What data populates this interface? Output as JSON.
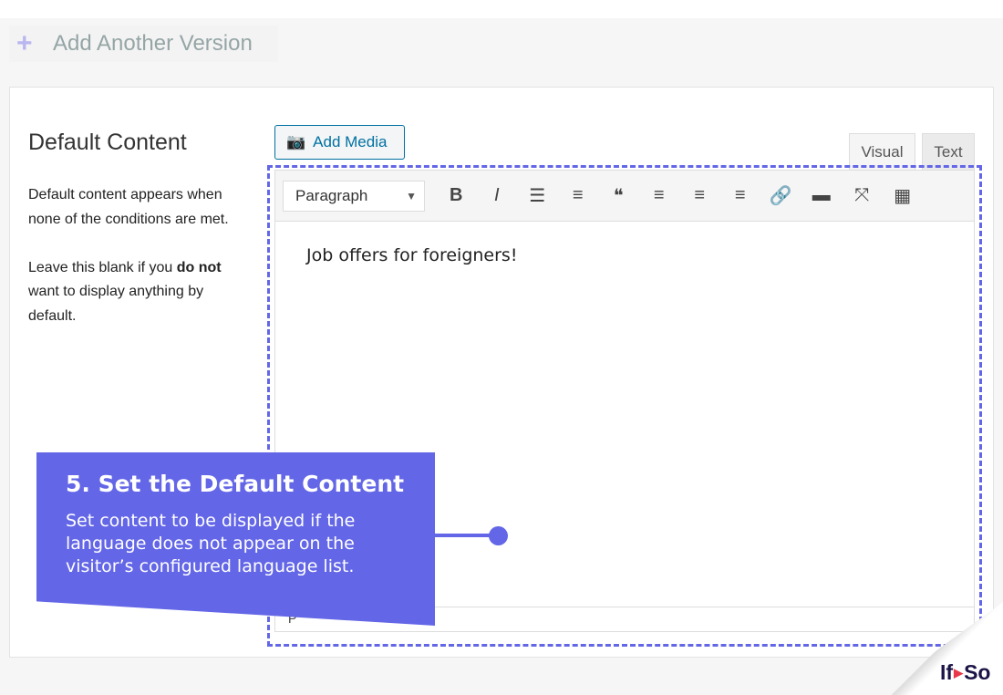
{
  "add_version": {
    "icon": "plus-icon",
    "label": "Add Another Version"
  },
  "section": {
    "title": "Default Content",
    "desc1": "Default content appears when none of the conditions are met.",
    "desc2_pre": "Leave this blank if you ",
    "desc2_bold": "do not",
    "desc2_post": " want to display anything by default."
  },
  "editor": {
    "add_media": "Add Media",
    "tabs": [
      "Visual",
      "Text"
    ],
    "format_select": "Paragraph",
    "toolbar": [
      {
        "name": "bold-icon",
        "glyph": "B"
      },
      {
        "name": "italic-icon",
        "glyph": "I"
      },
      {
        "name": "bullet-list-icon",
        "glyph": "☰"
      },
      {
        "name": "numbered-list-icon",
        "glyph": "≡"
      },
      {
        "name": "blockquote-icon",
        "glyph": "❝"
      },
      {
        "name": "align-left-icon",
        "glyph": "≡"
      },
      {
        "name": "align-center-icon",
        "glyph": "≡"
      },
      {
        "name": "align-right-icon",
        "glyph": "≡"
      },
      {
        "name": "link-icon",
        "glyph": "🔗"
      },
      {
        "name": "read-more-icon",
        "glyph": "▬"
      },
      {
        "name": "fullscreen-icon",
        "glyph": "⤧"
      },
      {
        "name": "toolbar-toggle-icon",
        "glyph": "▦"
      }
    ],
    "content": "Job offers for foreigners!",
    "status_path": "P"
  },
  "callout": {
    "title": "5. Set the Default Content",
    "body": "Set content to be displayed if the language does not appear on the visitor’s configured language list.",
    "color": "#6366e6"
  },
  "logo": {
    "left": "If",
    "right": "So"
  }
}
